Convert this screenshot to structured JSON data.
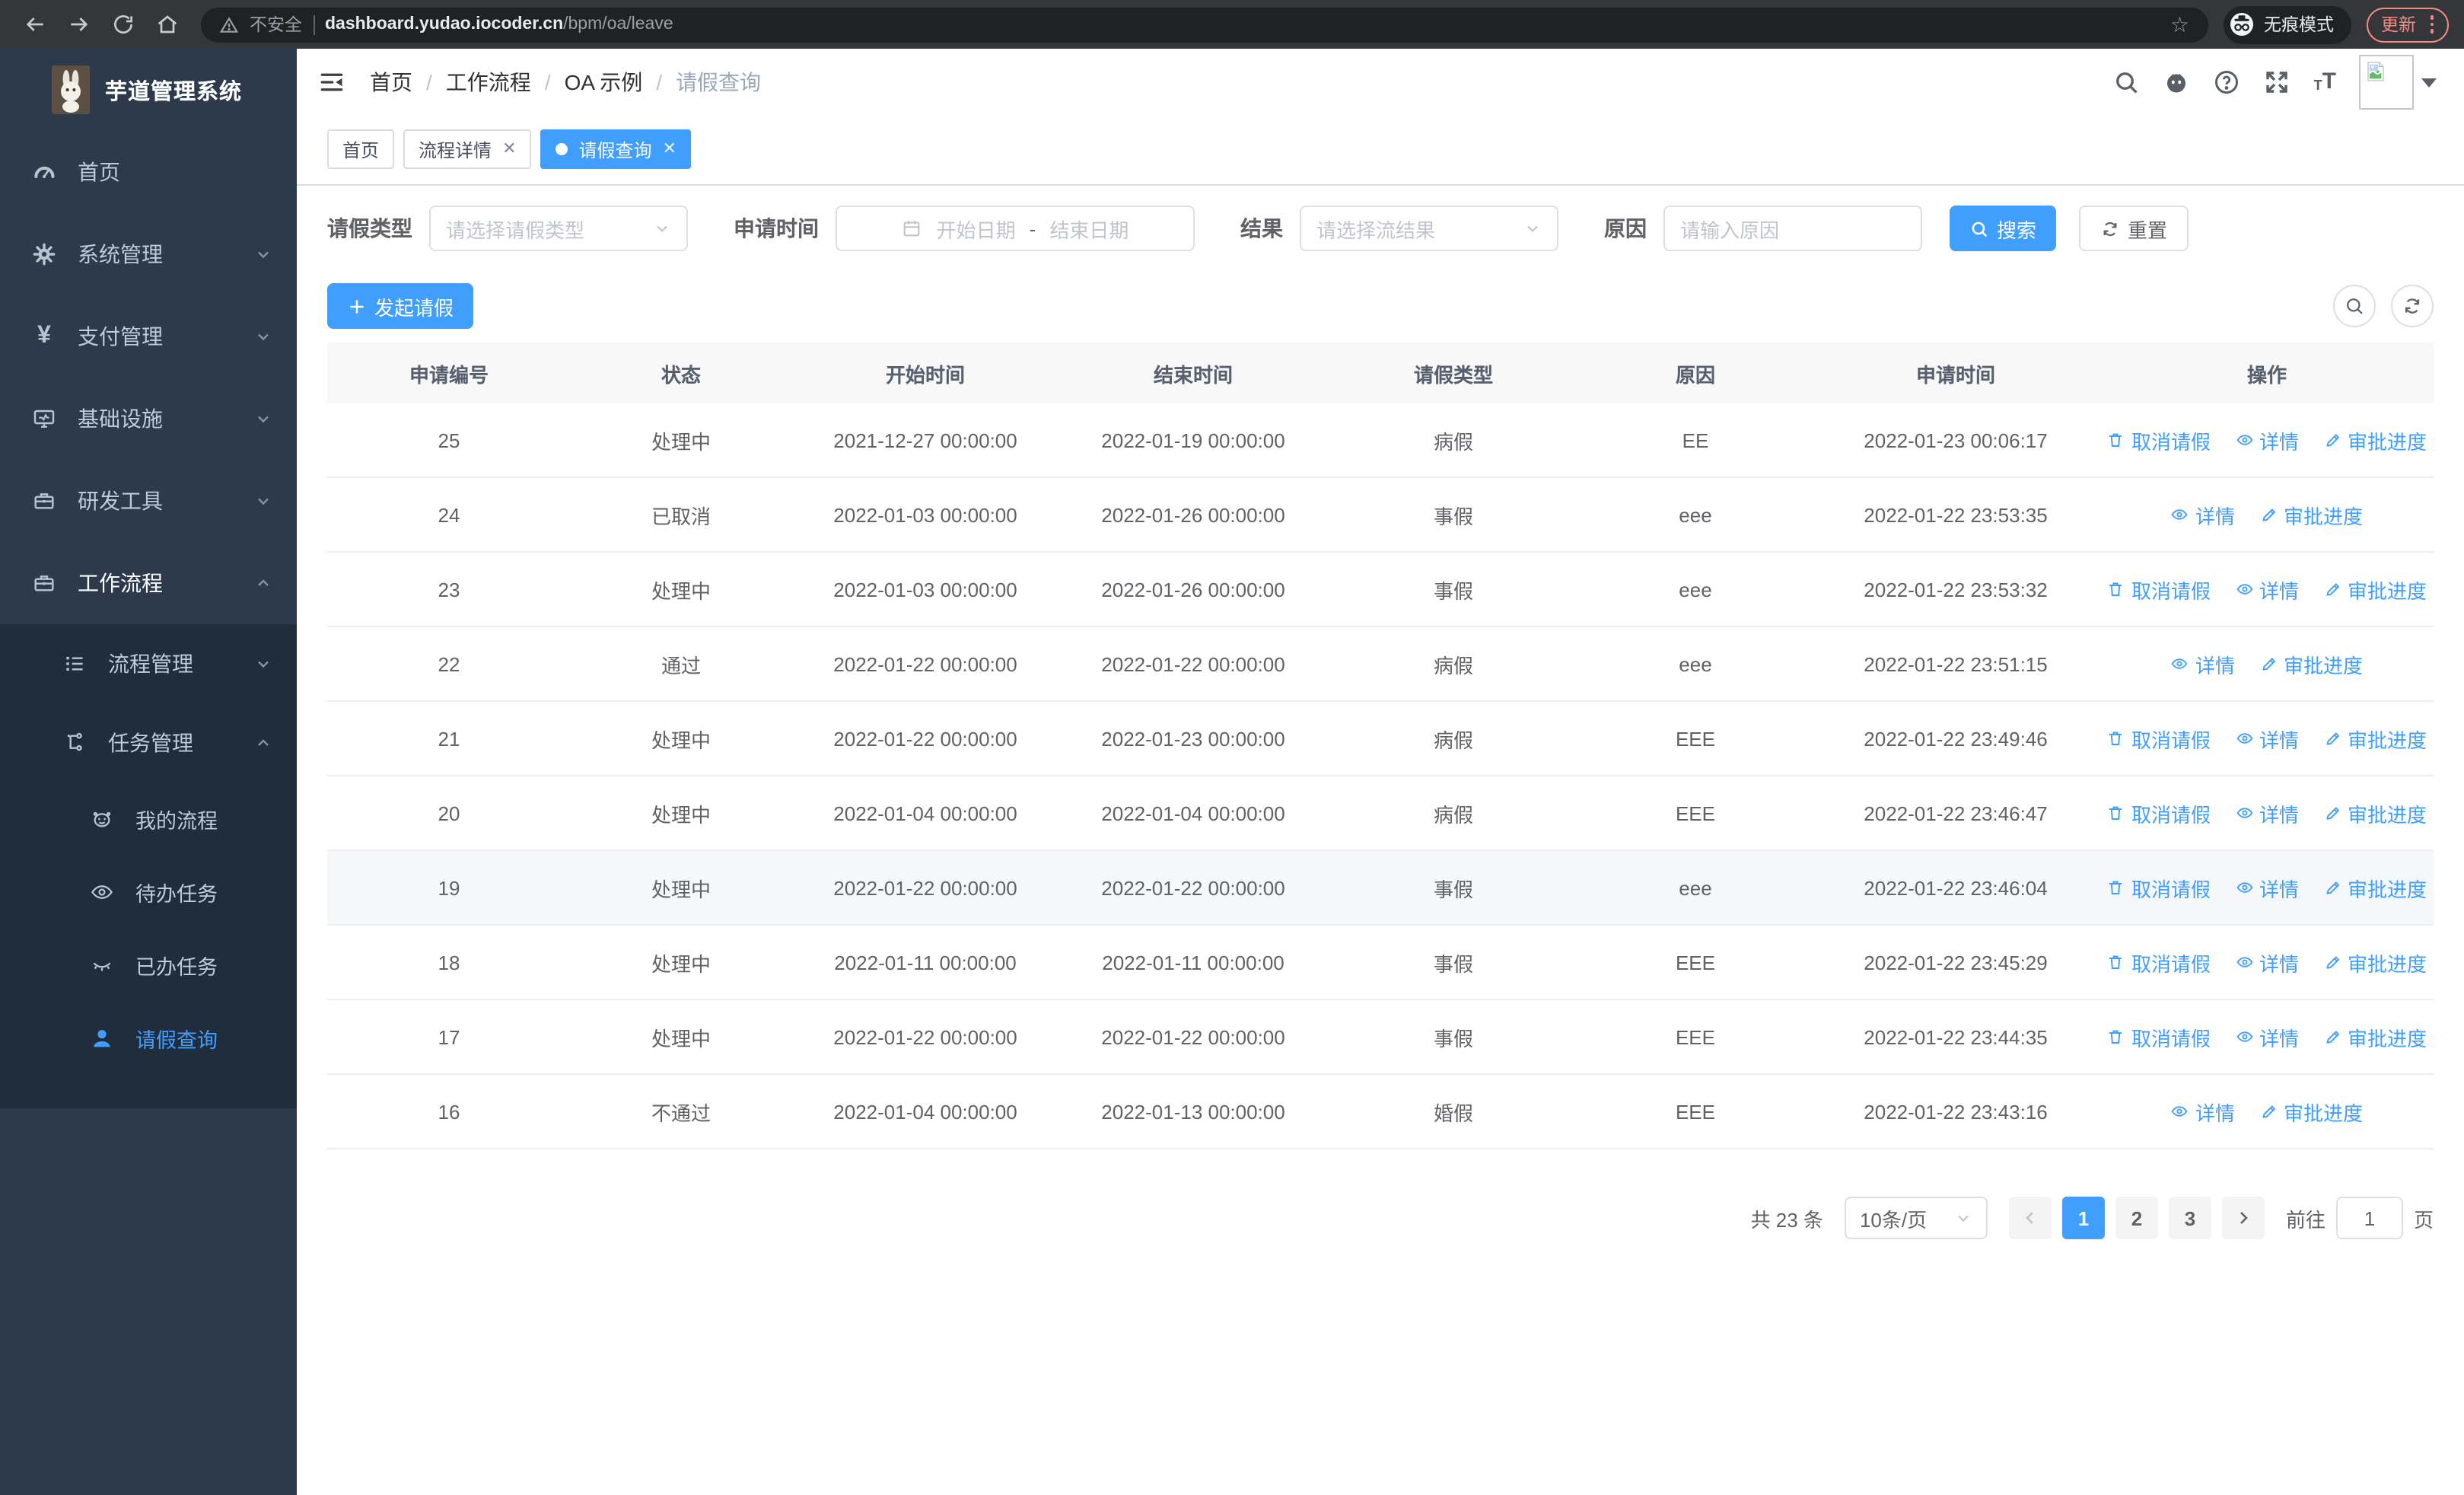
{
  "browser": {
    "security_warning": "不安全",
    "url_host": "dashboard.yudao.iocoder.cn",
    "url_path": "/bpm/oa/leave",
    "incognito_label": "无痕模式",
    "update_label": "更新"
  },
  "sidebar": {
    "logo_title": "芋道管理系统",
    "items": [
      {
        "label": "首页",
        "icon": "dashboard-icon"
      },
      {
        "label": "系统管理",
        "icon": "gear-icon"
      },
      {
        "label": "支付管理",
        "icon": "yen-icon"
      },
      {
        "label": "基础设施",
        "icon": "monitor-icon"
      },
      {
        "label": "研发工具",
        "icon": "toolbox-icon"
      },
      {
        "label": "工作流程",
        "icon": "briefcase-icon"
      }
    ],
    "submenu": [
      {
        "label": "流程管理",
        "icon": "list-icon"
      },
      {
        "label": "任务管理",
        "icon": "tree-icon"
      }
    ],
    "task_children": [
      {
        "label": "我的流程",
        "icon": "robot-icon"
      },
      {
        "label": "待办任务",
        "icon": "eye-icon"
      },
      {
        "label": "已办任务",
        "icon": "eye-closed-icon"
      },
      {
        "label": "请假查询",
        "icon": "user-icon"
      }
    ]
  },
  "header": {
    "breadcrumb": [
      "首页",
      "工作流程",
      "OA 示例",
      "请假查询"
    ]
  },
  "tabs": [
    {
      "label": "首页"
    },
    {
      "label": "流程详情"
    },
    {
      "label": "请假查询"
    }
  ],
  "filters": {
    "leave_type_label": "请假类型",
    "leave_type_placeholder": "请选择请假类型",
    "apply_time_label": "申请时间",
    "date_start_placeholder": "开始日期",
    "date_separator": "-",
    "date_end_placeholder": "结束日期",
    "result_label": "结果",
    "result_placeholder": "请选择流结果",
    "reason_label": "原因",
    "reason_placeholder": "请输入原因",
    "search_label": "搜索",
    "reset_label": "重置"
  },
  "toolbar": {
    "create_label": "发起请假"
  },
  "table": {
    "columns": [
      "申请编号",
      "状态",
      "开始时间",
      "结束时间",
      "请假类型",
      "原因",
      "申请时间",
      "操作"
    ],
    "action_labels": {
      "cancel": "取消请假",
      "detail": "详情",
      "progress": "审批进度"
    },
    "rows": [
      {
        "id": "25",
        "status": "处理中",
        "start": "2021-12-27 00:00:00",
        "end": "2022-01-19 00:00:00",
        "type": "病假",
        "reason": "EE",
        "apply": "2022-01-23 00:06:17",
        "actions": [
          "cancel",
          "detail",
          "progress"
        ],
        "highlight": false
      },
      {
        "id": "24",
        "status": "已取消",
        "start": "2022-01-03 00:00:00",
        "end": "2022-01-26 00:00:00",
        "type": "事假",
        "reason": "eee",
        "apply": "2022-01-22 23:53:35",
        "actions": [
          "detail",
          "progress"
        ],
        "highlight": false
      },
      {
        "id": "23",
        "status": "处理中",
        "start": "2022-01-03 00:00:00",
        "end": "2022-01-26 00:00:00",
        "type": "事假",
        "reason": "eee",
        "apply": "2022-01-22 23:53:32",
        "actions": [
          "cancel",
          "detail",
          "progress"
        ],
        "highlight": false
      },
      {
        "id": "22",
        "status": "通过",
        "start": "2022-01-22 00:00:00",
        "end": "2022-01-22 00:00:00",
        "type": "病假",
        "reason": "eee",
        "apply": "2022-01-22 23:51:15",
        "actions": [
          "detail",
          "progress"
        ],
        "highlight": false
      },
      {
        "id": "21",
        "status": "处理中",
        "start": "2022-01-22 00:00:00",
        "end": "2022-01-23 00:00:00",
        "type": "病假",
        "reason": "EEE",
        "apply": "2022-01-22 23:49:46",
        "actions": [
          "cancel",
          "detail",
          "progress"
        ],
        "highlight": false
      },
      {
        "id": "20",
        "status": "处理中",
        "start": "2022-01-04 00:00:00",
        "end": "2022-01-04 00:00:00",
        "type": "病假",
        "reason": "EEE",
        "apply": "2022-01-22 23:46:47",
        "actions": [
          "cancel",
          "detail",
          "progress"
        ],
        "highlight": false
      },
      {
        "id": "19",
        "status": "处理中",
        "start": "2022-01-22 00:00:00",
        "end": "2022-01-22 00:00:00",
        "type": "事假",
        "reason": "eee",
        "apply": "2022-01-22 23:46:04",
        "actions": [
          "cancel",
          "detail",
          "progress"
        ],
        "highlight": true
      },
      {
        "id": "18",
        "status": "处理中",
        "start": "2022-01-11 00:00:00",
        "end": "2022-01-11 00:00:00",
        "type": "事假",
        "reason": "EEE",
        "apply": "2022-01-22 23:45:29",
        "actions": [
          "cancel",
          "detail",
          "progress"
        ],
        "highlight": false
      },
      {
        "id": "17",
        "status": "处理中",
        "start": "2022-01-22 00:00:00",
        "end": "2022-01-22 00:00:00",
        "type": "事假",
        "reason": "EEE",
        "apply": "2022-01-22 23:44:35",
        "actions": [
          "cancel",
          "detail",
          "progress"
        ],
        "highlight": false
      },
      {
        "id": "16",
        "status": "不通过",
        "start": "2022-01-04 00:00:00",
        "end": "2022-01-13 00:00:00",
        "type": "婚假",
        "reason": "EEE",
        "apply": "2022-01-22 23:43:16",
        "actions": [
          "detail",
          "progress"
        ],
        "highlight": false
      }
    ]
  },
  "pagination": {
    "total_label": "共 23 条",
    "page_size_label": "10条/页",
    "pages": [
      "1",
      "2",
      "3"
    ],
    "active_page": "1",
    "goto_label": "前往",
    "goto_value": "1",
    "page_unit": "页"
  },
  "colors": {
    "accent": "#409eff",
    "sidebar_bg": "#2d3a4b",
    "submenu_bg": "#1f2d3d",
    "chrome_bg": "#35363a",
    "update_red": "#f28b82"
  }
}
